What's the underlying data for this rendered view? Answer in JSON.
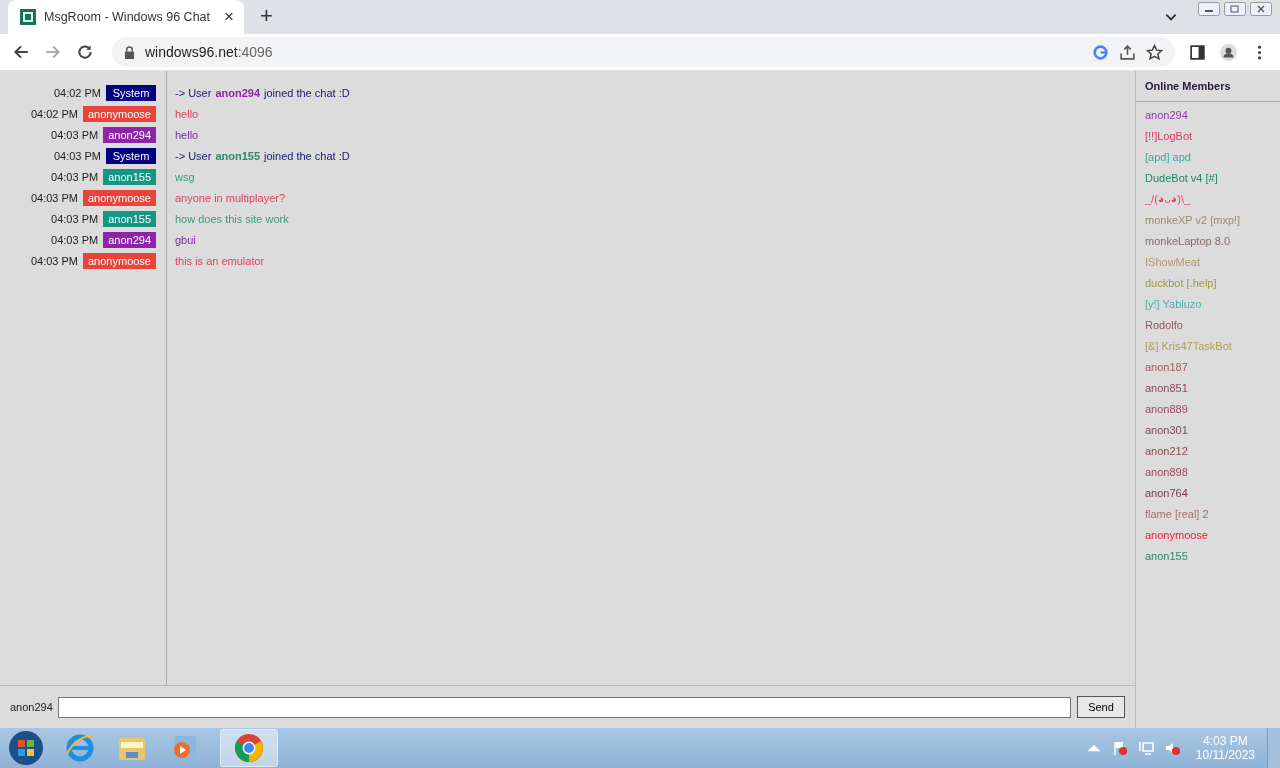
{
  "browser": {
    "tab": {
      "title": "MsgRoom - Windows 96 Chat",
      "close": "×"
    },
    "new_tab": "+",
    "url_host": "windows96.net",
    "url_port": ":4096"
  },
  "messages": [
    {
      "time": "04:02 PM",
      "sender": {
        "name": "System",
        "color": "#000080"
      },
      "body": [
        {
          "kind": "plain",
          "text": "-> User",
          "color": "#1a1a6e"
        },
        {
          "kind": "name",
          "text": "anon294",
          "color": "#8e24aa"
        },
        {
          "kind": "plain",
          "text": "joined the chat :D",
          "color": "#1a1a6e"
        }
      ]
    },
    {
      "time": "04:02 PM",
      "sender": {
        "name": "anonymoose",
        "color": "#e8443a"
      },
      "body": [
        {
          "kind": "plain",
          "text": "hello",
          "color": "#e0405a"
        }
      ]
    },
    {
      "time": "04:03 PM",
      "sender": {
        "name": "anon294",
        "color": "#8e24aa"
      },
      "body": [
        {
          "kind": "plain",
          "text": "hello",
          "color": "#7b2a9a"
        }
      ]
    },
    {
      "time": "04:03 PM",
      "sender": {
        "name": "System",
        "color": "#000080"
      },
      "body": [
        {
          "kind": "plain",
          "text": "-> User",
          "color": "#1a1a6e"
        },
        {
          "kind": "name",
          "text": "anon155",
          "color": "#2a8a70"
        },
        {
          "kind": "plain",
          "text": "joined the chat :D",
          "color": "#1a1a6e"
        }
      ]
    },
    {
      "time": "04:03 PM",
      "sender": {
        "name": "anon155",
        "color": "#169685"
      },
      "body": [
        {
          "kind": "plain",
          "text": "wsg",
          "color": "#3a9a7a"
        }
      ]
    },
    {
      "time": "04:03 PM",
      "sender": {
        "name": "anonymoose",
        "color": "#e8443a"
      },
      "body": [
        {
          "kind": "plain",
          "text": "anyone in multiplayer?",
          "color": "#e0405a"
        }
      ]
    },
    {
      "time": "04:03 PM",
      "sender": {
        "name": "anon155",
        "color": "#169685"
      },
      "body": [
        {
          "kind": "plain",
          "text": "how does this site work",
          "color": "#3a9a7a"
        }
      ]
    },
    {
      "time": "04:03 PM",
      "sender": {
        "name": "anon294",
        "color": "#8e24aa"
      },
      "body": [
        {
          "kind": "plain",
          "text": "gbui",
          "color": "#7b2a9a"
        }
      ]
    },
    {
      "time": "04:03 PM",
      "sender": {
        "name": "anonymoose",
        "color": "#e8443a"
      },
      "body": [
        {
          "kind": "plain",
          "text": "this is an emulator",
          "color": "#e0405a"
        }
      ]
    }
  ],
  "members_title": "Online Members",
  "members": [
    {
      "name": "anon294",
      "color": "#8e3aa8"
    },
    {
      "name": "[!!]LogBot",
      "color": "#e03a5a"
    },
    {
      "name": "[apd] apd",
      "color": "#3aaaa0"
    },
    {
      "name": "DudeBot v4 [#]",
      "color": "#1a8a6a"
    },
    {
      "name": "_/(◕ᴗ◕)\\_",
      "color": "#e04a5a"
    },
    {
      "name": "monkeXP v2 [mxp!]",
      "color": "#a08a70"
    },
    {
      "name": "monkeLaptop 8.0",
      "color": "#8a6a6a"
    },
    {
      "name": "IShowMeat",
      "color": "#b09a70"
    },
    {
      "name": "duckbot [.help]",
      "color": "#9a9a4a"
    },
    {
      "name": "[y!] Yabluzo",
      "color": "#4ab0a8"
    },
    {
      "name": "Rodolfo",
      "color": "#8a5a5a"
    },
    {
      "name": "[&] Kris47TaskBot",
      "color": "#b0a050"
    },
    {
      "name": "anon187",
      "color": "#a05a5a"
    },
    {
      "name": "anon851",
      "color": "#8a4a5a"
    },
    {
      "name": "anon889",
      "color": "#9a4a6a"
    },
    {
      "name": "anon301",
      "color": "#7a4a5a"
    },
    {
      "name": "anon212",
      "color": "#8a4a4a"
    },
    {
      "name": "anon898",
      "color": "#9a4a5a"
    },
    {
      "name": "anon764",
      "color": "#7a3a4a"
    },
    {
      "name": "flame [real] 2",
      "color": "#b06a6a"
    },
    {
      "name": "anonymoose",
      "color": "#e8243a"
    },
    {
      "name": "anon155",
      "color": "#2a8a70"
    }
  ],
  "composer": {
    "username": "anon294",
    "send": "Send"
  },
  "taskbar": {
    "time": "4:03 PM",
    "date": "10/11/2023"
  }
}
